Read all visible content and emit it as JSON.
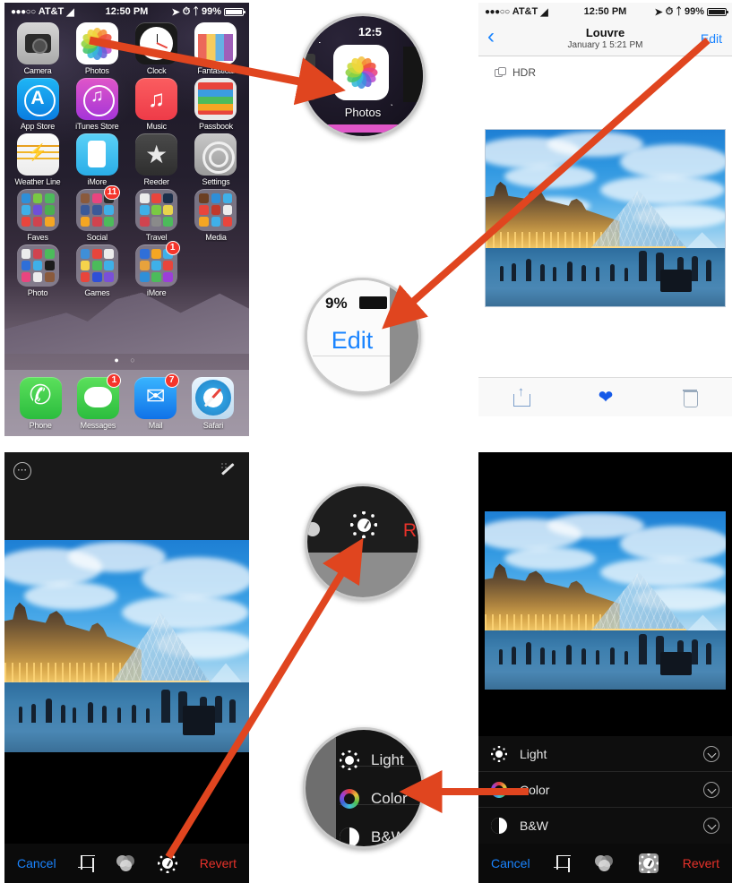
{
  "statusbar": {
    "signal_dots": "●●●○○",
    "carrier": "AT&T",
    "wifi_icon": "wifi-icon",
    "time": "12:50 PM",
    "location_icon": "location-arrow-icon",
    "alarm_icon": "alarm-clock-icon",
    "bluetooth_icon": "bluetooth-icon",
    "battery_pct": "99%"
  },
  "homescreen": {
    "rows": [
      [
        {
          "label": "Camera",
          "icon": "camera-icon",
          "badge": null
        },
        {
          "label": "Photos",
          "icon": "photos-icon",
          "badge": null
        },
        {
          "label": "Clock",
          "icon": "clock-icon",
          "badge": null
        },
        {
          "label": "Fantastical",
          "icon": "fantastical-icon",
          "badge": null
        }
      ],
      [
        {
          "label": "App Store",
          "icon": "app-store-icon",
          "badge": null
        },
        {
          "label": "iTunes Store",
          "icon": "itunes-store-icon",
          "badge": null
        },
        {
          "label": "Music",
          "icon": "music-icon",
          "badge": null
        },
        {
          "label": "Passbook",
          "icon": "passbook-icon",
          "badge": null
        }
      ],
      [
        {
          "label": "Weather Line",
          "icon": "weather-line-icon",
          "badge": null
        },
        {
          "label": "iMore",
          "icon": "imore-icon",
          "badge": null
        },
        {
          "label": "Reeder",
          "icon": "reeder-icon",
          "badge": null
        },
        {
          "label": "Settings",
          "icon": "settings-icon",
          "badge": null
        }
      ],
      [
        {
          "label": "Faves",
          "icon": "folder-icon",
          "badge": null
        },
        {
          "label": "Social",
          "icon": "folder-icon",
          "badge": "11"
        },
        {
          "label": "Travel",
          "icon": "folder-icon",
          "badge": null
        },
        {
          "label": "Media",
          "icon": "folder-icon",
          "badge": null
        }
      ],
      [
        {
          "label": "Photo",
          "icon": "folder-icon",
          "badge": null
        },
        {
          "label": "Games",
          "icon": "folder-icon",
          "badge": null
        },
        {
          "label": "iMore",
          "icon": "folder-icon",
          "badge": "1"
        },
        {
          "label": "",
          "icon": "empty-slot",
          "badge": null
        }
      ]
    ],
    "page_dots": "● ○",
    "dock": [
      {
        "label": "Phone",
        "icon": "phone-icon",
        "badge": null
      },
      {
        "label": "Messages",
        "icon": "messages-icon",
        "badge": "1"
      },
      {
        "label": "Mail",
        "icon": "mail-icon",
        "badge": "7"
      },
      {
        "label": "Safari",
        "icon": "safari-icon",
        "badge": null
      }
    ]
  },
  "viewer": {
    "back_icon": "chevron-left-icon",
    "title": "Louvre",
    "subtitle": "January 1  5:21 PM",
    "edit_label": "Edit",
    "hdr_label": "HDR",
    "toolbar": {
      "share_icon": "share-icon",
      "favorite_icon": "heart-icon",
      "delete_icon": "trash-icon"
    }
  },
  "editor": {
    "more_icon": "more-options-icon",
    "auto_enhance_icon": "magic-wand-icon",
    "cancel_label": "Cancel",
    "revert_label": "Revert",
    "crop_icon": "crop-icon",
    "filters_icon": "filters-icon",
    "adjust_icon": "adjust-dial-icon"
  },
  "adjust": {
    "rows": [
      {
        "label": "Light",
        "icon": "light-sun-icon",
        "chevron": "chevron-down-circle-icon"
      },
      {
        "label": "Color",
        "icon": "color-wheel-icon",
        "chevron": "chevron-down-circle-icon"
      },
      {
        "label": "B&W",
        "icon": "black-white-icon",
        "chevron": "chevron-down-circle-icon"
      }
    ],
    "cancel_label": "Cancel",
    "revert_label": "Revert",
    "crop_icon": "crop-icon",
    "filters_icon": "filters-icon",
    "adjust_icon": "adjust-dial-icon"
  },
  "magnifiers": {
    "photos": {
      "time_fragment": "12:5",
      "label": "Photos",
      "icon": "photos-icon"
    },
    "edit": {
      "battery_fragment": "9%",
      "label": "Edit"
    },
    "dial": {
      "icon": "adjust-dial-icon",
      "revert_fragment": "R"
    },
    "color": {
      "rows": [
        {
          "label": "Light",
          "icon": "light-sun-icon"
        },
        {
          "label": "Color",
          "icon": "color-wheel-icon"
        },
        {
          "label": "B&W",
          "icon": "black-white-icon"
        }
      ]
    }
  },
  "colors": {
    "ios_blue": "#1a84ff",
    "revert_red": "#e8322a",
    "arrow_red": "#e0451f",
    "badge_red": "#f5352b",
    "favorite_blue": "#1559e8"
  }
}
